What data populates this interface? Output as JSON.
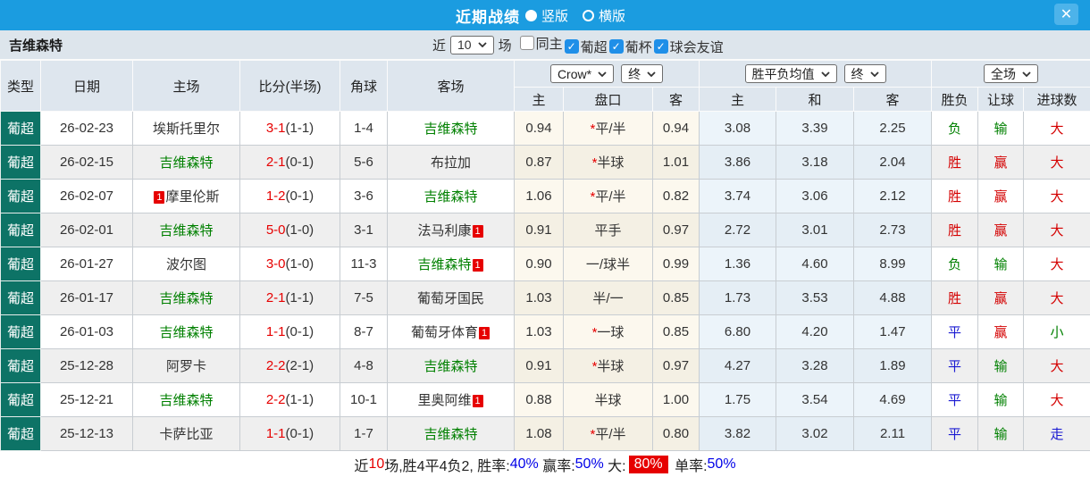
{
  "header": {
    "title": "近期战绩",
    "close_glyph": "✕",
    "view_options": [
      {
        "label": "竖版",
        "selected": true
      },
      {
        "label": "横版",
        "selected": false
      }
    ]
  },
  "filter": {
    "team": "吉维森特",
    "near_label": "近",
    "count_value": "10",
    "games_label": "场",
    "check_glyph": "✓",
    "checkboxes": [
      {
        "label": "同主",
        "checked": false
      },
      {
        "label": "葡超",
        "checked": true
      },
      {
        "label": "葡杯",
        "checked": true
      },
      {
        "label": "球会友谊",
        "checked": true
      }
    ]
  },
  "table": {
    "left_headers": [
      "类型",
      "日期",
      "主场",
      "比分(半场)",
      "角球",
      "客场"
    ],
    "selects": {
      "company": "Crow*",
      "company_period": "终",
      "avg": "胜平负均值",
      "avg_period": "终",
      "scope": "全场"
    },
    "sub_headers": [
      "主",
      "盘口",
      "客",
      "主",
      "和",
      "客",
      "胜负",
      "让球",
      "进球数"
    ],
    "star_glyph": "*",
    "colors": {
      "league_bg": "#0d7366",
      "topbar_blue": "#1b9ce0",
      "team_green": "#008000",
      "win_red": "#d40000",
      "draw_blue": "#1a1ad2",
      "odds_cream": "#fcf8ee",
      "avg_blue": "#ecf4fa"
    },
    "rows": [
      {
        "league": "葡超",
        "date": "26-02-23",
        "home": {
          "name": "埃斯托里尔",
          "green": false
        },
        "away": {
          "name": "吉维森特",
          "green": true
        },
        "score": "3-1",
        "half": "(1-1)",
        "corner": "1-4",
        "odds": {
          "home": "0.94",
          "star": true,
          "line": "平/半",
          "away": "0.94"
        },
        "avg": {
          "home": "3.08",
          "draw": "3.39",
          "away": "2.25"
        },
        "result": {
          "outcome": {
            "t": "负",
            "c": "green"
          },
          "handicap": {
            "t": "输",
            "c": "green"
          },
          "goals": {
            "t": "大",
            "c": "red"
          }
        }
      },
      {
        "league": "葡超",
        "date": "26-02-15",
        "home": {
          "name": "吉维森特",
          "green": true
        },
        "away": {
          "name": "布拉加",
          "green": false
        },
        "score": "2-1",
        "half": "(0-1)",
        "corner": "5-6",
        "odds": {
          "home": "0.87",
          "star": true,
          "line": "半球",
          "away": "1.01"
        },
        "avg": {
          "home": "3.86",
          "draw": "3.18",
          "away": "2.04"
        },
        "result": {
          "outcome": {
            "t": "胜",
            "c": "red"
          },
          "handicap": {
            "t": "赢",
            "c": "red"
          },
          "goals": {
            "t": "大",
            "c": "red"
          }
        }
      },
      {
        "league": "葡超",
        "date": "26-02-07",
        "home": {
          "name": "摩里伦斯",
          "green": false,
          "badge_before": "1"
        },
        "away": {
          "name": "吉维森特",
          "green": true
        },
        "score": "1-2",
        "half": "(0-1)",
        "corner": "3-6",
        "odds": {
          "home": "1.06",
          "star": true,
          "line": "平/半",
          "away": "0.82"
        },
        "avg": {
          "home": "3.74",
          "draw": "3.06",
          "away": "2.12"
        },
        "result": {
          "outcome": {
            "t": "胜",
            "c": "red"
          },
          "handicap": {
            "t": "赢",
            "c": "red"
          },
          "goals": {
            "t": "大",
            "c": "red"
          }
        }
      },
      {
        "league": "葡超",
        "date": "26-02-01",
        "home": {
          "name": "吉维森特",
          "green": true
        },
        "away": {
          "name": "法马利康",
          "green": false,
          "badge_after": "1"
        },
        "score": "5-0",
        "half": "(1-0)",
        "corner": "3-1",
        "odds": {
          "home": "0.91",
          "star": false,
          "line": "平手",
          "away": "0.97"
        },
        "avg": {
          "home": "2.72",
          "draw": "3.01",
          "away": "2.73"
        },
        "result": {
          "outcome": {
            "t": "胜",
            "c": "red"
          },
          "handicap": {
            "t": "赢",
            "c": "red"
          },
          "goals": {
            "t": "大",
            "c": "red"
          }
        }
      },
      {
        "league": "葡超",
        "date": "26-01-27",
        "home": {
          "name": "波尔图",
          "green": false
        },
        "away": {
          "name": "吉维森特",
          "green": true,
          "badge_after": "1"
        },
        "score": "3-0",
        "half": "(1-0)",
        "corner": "11-3",
        "odds": {
          "home": "0.90",
          "star": false,
          "line": "一/球半",
          "away": "0.99"
        },
        "avg": {
          "home": "1.36",
          "draw": "4.60",
          "away": "8.99"
        },
        "result": {
          "outcome": {
            "t": "负",
            "c": "green"
          },
          "handicap": {
            "t": "输",
            "c": "green"
          },
          "goals": {
            "t": "大",
            "c": "red"
          }
        }
      },
      {
        "league": "葡超",
        "date": "26-01-17",
        "home": {
          "name": "吉维森特",
          "green": true
        },
        "away": {
          "name": "葡萄牙国民",
          "green": false
        },
        "score": "2-1",
        "half": "(1-1)",
        "corner": "7-5",
        "odds": {
          "home": "1.03",
          "star": false,
          "line": "半/一",
          "away": "0.85"
        },
        "avg": {
          "home": "1.73",
          "draw": "3.53",
          "away": "4.88"
        },
        "result": {
          "outcome": {
            "t": "胜",
            "c": "red"
          },
          "handicap": {
            "t": "赢",
            "c": "red"
          },
          "goals": {
            "t": "大",
            "c": "red"
          }
        }
      },
      {
        "league": "葡超",
        "date": "26-01-03",
        "home": {
          "name": "吉维森特",
          "green": true
        },
        "away": {
          "name": "葡萄牙体育",
          "green": false,
          "badge_after": "1"
        },
        "score": "1-1",
        "half": "(0-1)",
        "corner": "8-7",
        "odds": {
          "home": "1.03",
          "star": true,
          "line": "一球",
          "away": "0.85"
        },
        "avg": {
          "home": "6.80",
          "draw": "4.20",
          "away": "1.47"
        },
        "result": {
          "outcome": {
            "t": "平",
            "c": "blue"
          },
          "handicap": {
            "t": "赢",
            "c": "red"
          },
          "goals": {
            "t": "小",
            "c": "green"
          }
        }
      },
      {
        "league": "葡超",
        "date": "25-12-28",
        "home": {
          "name": "阿罗卡",
          "green": false
        },
        "away": {
          "name": "吉维森特",
          "green": true
        },
        "score": "2-2",
        "half": "(2-1)",
        "corner": "4-8",
        "odds": {
          "home": "0.91",
          "star": true,
          "line": "半球",
          "away": "0.97"
        },
        "avg": {
          "home": "4.27",
          "draw": "3.28",
          "away": "1.89"
        },
        "result": {
          "outcome": {
            "t": "平",
            "c": "blue"
          },
          "handicap": {
            "t": "输",
            "c": "green"
          },
          "goals": {
            "t": "大",
            "c": "red"
          }
        }
      },
      {
        "league": "葡超",
        "date": "25-12-21",
        "home": {
          "name": "吉维森特",
          "green": true
        },
        "away": {
          "name": "里奥阿维",
          "green": false,
          "badge_after": "1"
        },
        "score": "2-2",
        "half": "(1-1)",
        "corner": "10-1",
        "odds": {
          "home": "0.88",
          "star": false,
          "line": "半球",
          "away": "1.00"
        },
        "avg": {
          "home": "1.75",
          "draw": "3.54",
          "away": "4.69"
        },
        "result": {
          "outcome": {
            "t": "平",
            "c": "blue"
          },
          "handicap": {
            "t": "输",
            "c": "green"
          },
          "goals": {
            "t": "大",
            "c": "red"
          }
        }
      },
      {
        "league": "葡超",
        "date": "25-12-13",
        "home": {
          "name": "卡萨比亚",
          "green": false
        },
        "away": {
          "name": "吉维森特",
          "green": true
        },
        "score": "1-1",
        "half": "(0-1)",
        "corner": "1-7",
        "odds": {
          "home": "1.08",
          "star": true,
          "line": "平/半",
          "away": "0.80"
        },
        "avg": {
          "home": "3.82",
          "draw": "3.02",
          "away": "2.11"
        },
        "result": {
          "outcome": {
            "t": "平",
            "c": "blue"
          },
          "handicap": {
            "t": "输",
            "c": "green"
          },
          "goals": {
            "t": "走",
            "c": "blue"
          }
        }
      }
    ]
  },
  "summary": {
    "segments": [
      {
        "t": "近"
      },
      {
        "t": "10",
        "cls": "red"
      },
      {
        "t": "场,胜4平4负2, 胜率:"
      },
      {
        "t": "40%",
        "cls": "blue"
      },
      {
        "t": " 赢率:"
      },
      {
        "t": "50%",
        "cls": "blue"
      },
      {
        "t": " 大:"
      },
      {
        "t": "80%",
        "cls": "redbg"
      },
      {
        "t": " 单率:"
      },
      {
        "t": "50%",
        "cls": "blue"
      }
    ]
  }
}
